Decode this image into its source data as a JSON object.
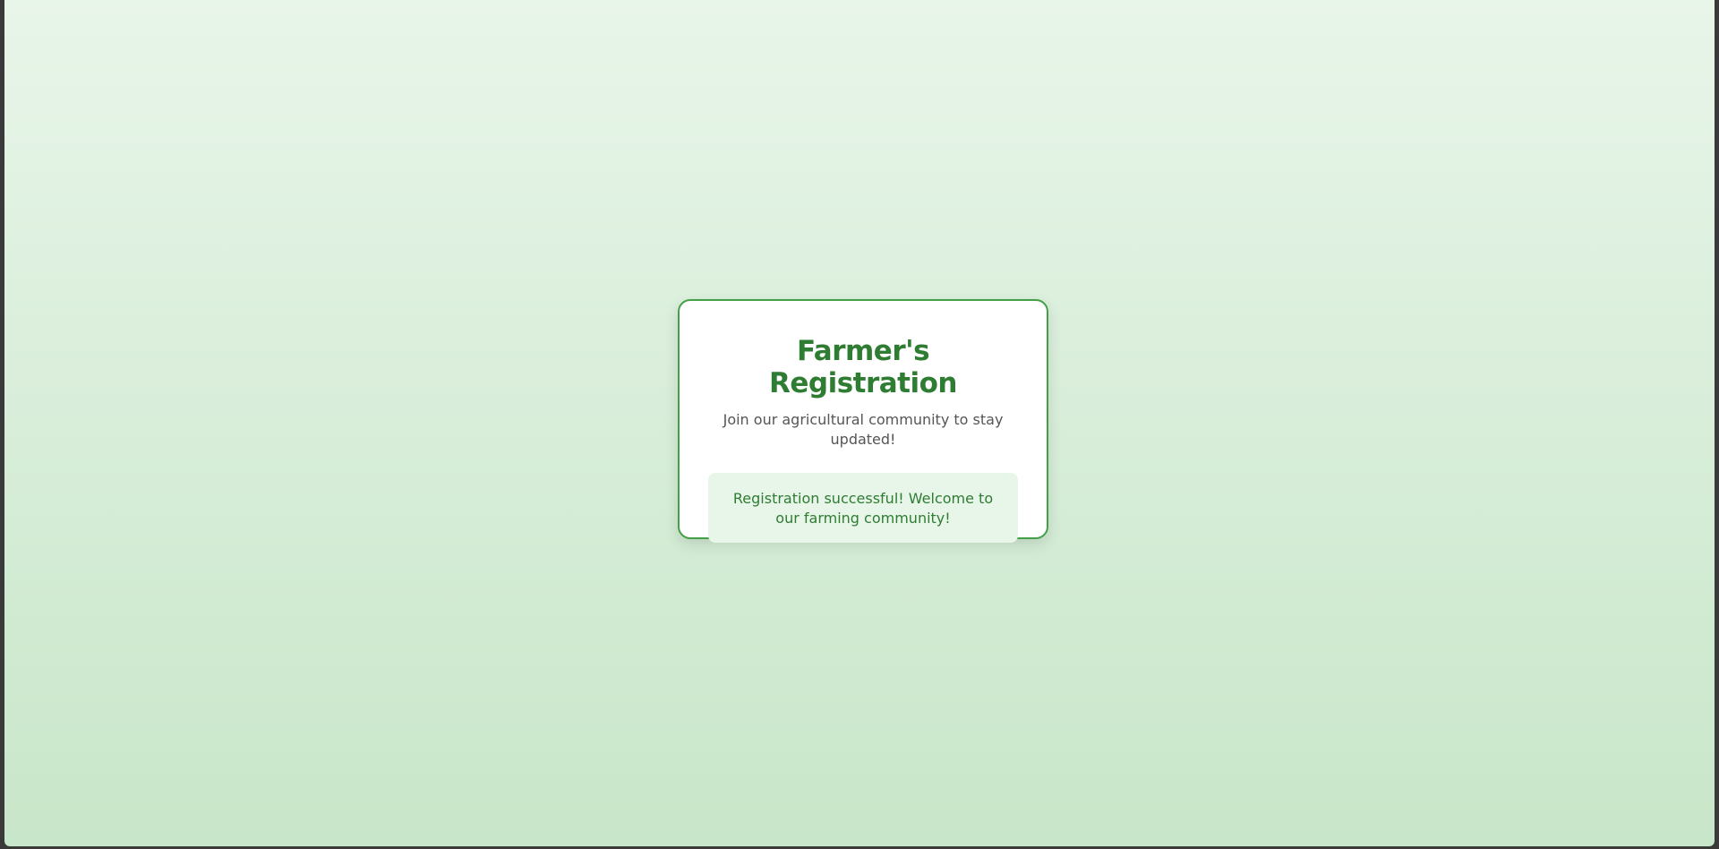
{
  "registration": {
    "title": "Farmer's Registration",
    "subtitle": "Join our agricultural community to stay updated!",
    "success_message": "Registration successful! Welcome to our farming community!"
  },
  "colors": {
    "accent": "#2e7d32",
    "border": "#43a047",
    "background_top": "#e8f5e9",
    "background_bottom": "#c8e6c9",
    "success_background": "#e8f5e9",
    "subtitle_text": "#555555"
  }
}
